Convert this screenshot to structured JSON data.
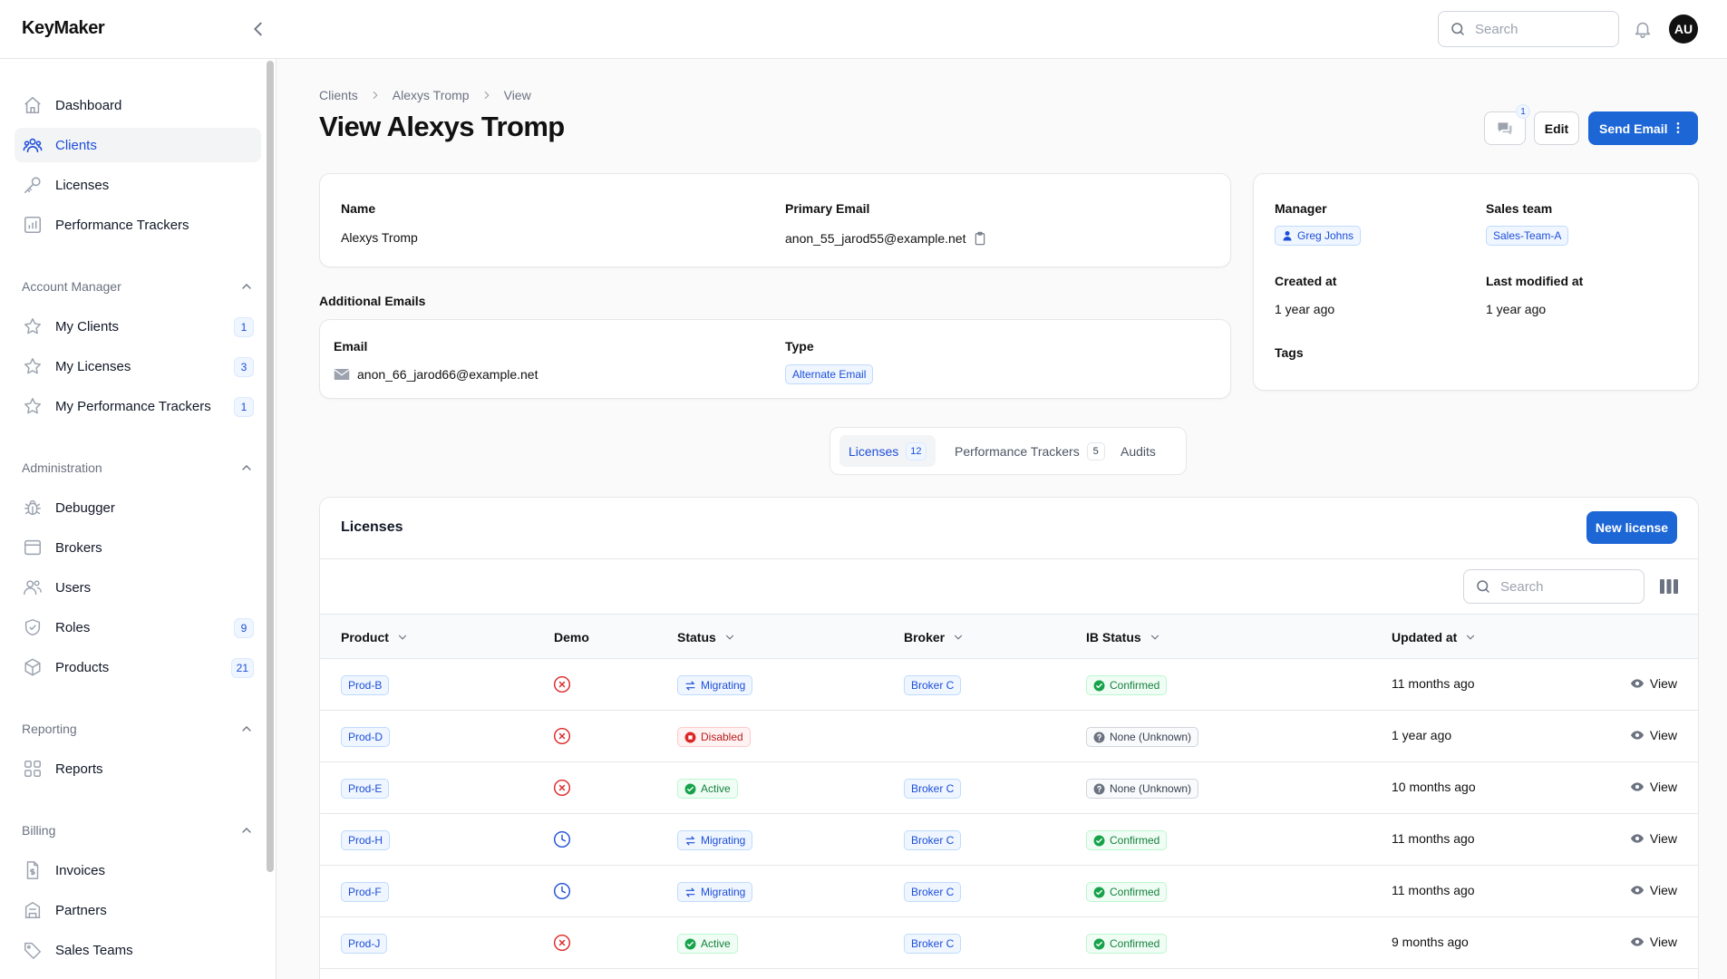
{
  "app": {
    "name": "KeyMaker"
  },
  "topbar": {
    "search_placeholder": "Search",
    "user_initials": "AU"
  },
  "sidebar": {
    "main": [
      {
        "label": "Dashboard",
        "icon": "home-icon"
      },
      {
        "label": "Clients",
        "icon": "users-icon",
        "active": true
      },
      {
        "label": "Licenses",
        "icon": "key-icon"
      },
      {
        "label": "Performance Trackers",
        "icon": "chart-icon"
      }
    ],
    "groups": [
      {
        "title": "Account Manager",
        "items": [
          {
            "label": "My Clients",
            "icon": "star-icon",
            "count": "1"
          },
          {
            "label": "My Licenses",
            "icon": "star-icon",
            "count": "3"
          },
          {
            "label": "My Performance Trackers",
            "icon": "star-icon",
            "count": "1"
          }
        ]
      },
      {
        "title": "Administration",
        "items": [
          {
            "label": "Debugger",
            "icon": "bug-icon"
          },
          {
            "label": "Brokers",
            "icon": "inbox-icon"
          },
          {
            "label": "Users",
            "icon": "users-icon"
          },
          {
            "label": "Roles",
            "icon": "shield-icon",
            "count": "9"
          },
          {
            "label": "Products",
            "icon": "cube-icon",
            "count": "21"
          }
        ]
      },
      {
        "title": "Reporting",
        "items": [
          {
            "label": "Reports",
            "icon": "grid-icon"
          }
        ]
      },
      {
        "title": "Billing",
        "items": [
          {
            "label": "Invoices",
            "icon": "invoice-icon"
          },
          {
            "label": "Partners",
            "icon": "building-icon"
          },
          {
            "label": "Sales Teams",
            "icon": "tag-icon"
          }
        ]
      }
    ]
  },
  "breadcrumbs": [
    "Clients",
    "Alexys Tromp",
    "View"
  ],
  "page": {
    "title": "View Alexys Tromp",
    "comments_count": "1",
    "edit_label": "Edit",
    "send_email_label": "Send Email"
  },
  "client": {
    "name_label": "Name",
    "name": "Alexys Tromp",
    "email_label": "Primary Email",
    "email": "anon_55_jarod55@example.net"
  },
  "additional_emails": {
    "title": "Additional Emails",
    "email_header": "Email",
    "type_header": "Type",
    "rows": [
      {
        "email": "anon_66_jarod66@example.net",
        "type": "Alternate Email"
      }
    ]
  },
  "meta": {
    "manager_label": "Manager",
    "manager": "Greg Johns",
    "sales_team_label": "Sales team",
    "sales_team": "Sales-Team-A",
    "created_label": "Created at",
    "created": "1 year ago",
    "modified_label": "Last modified at",
    "modified": "1 year ago",
    "tags_label": "Tags"
  },
  "tabs": [
    {
      "label": "Licenses",
      "count": "12",
      "active": true
    },
    {
      "label": "Performance Trackers",
      "count": "5"
    },
    {
      "label": "Audits"
    }
  ],
  "licenses": {
    "title": "Licenses",
    "new_label": "New license",
    "search_placeholder": "Search",
    "columns": [
      "Product",
      "Demo",
      "Status",
      "Broker",
      "IB Status",
      "Updated at"
    ],
    "view_label": "View",
    "colors": {
      "blue": "#1d4ed8",
      "green": "#16a34a",
      "red": "#dc2626",
      "gray": "#6b7280"
    },
    "rows": [
      {
        "product": "Prod-B",
        "demo": "no",
        "status": "Migrating",
        "broker": "Broker C",
        "ib_status": "Confirmed",
        "updated": "11 months ago"
      },
      {
        "product": "Prod-D",
        "demo": "no",
        "status": "Disabled",
        "broker": "",
        "ib_status": "None (Unknown)",
        "updated": "1 year ago"
      },
      {
        "product": "Prod-E",
        "demo": "no",
        "status": "Active",
        "broker": "Broker C",
        "ib_status": "None (Unknown)",
        "updated": "10 months ago"
      },
      {
        "product": "Prod-H",
        "demo": "pending",
        "status": "Migrating",
        "broker": "Broker C",
        "ib_status": "Confirmed",
        "updated": "11 months ago"
      },
      {
        "product": "Prod-F",
        "demo": "pending",
        "status": "Migrating",
        "broker": "Broker C",
        "ib_status": "Confirmed",
        "updated": "11 months ago"
      },
      {
        "product": "Prod-J",
        "demo": "no",
        "status": "Active",
        "broker": "Broker C",
        "ib_status": "Confirmed",
        "updated": "9 months ago"
      }
    ]
  }
}
